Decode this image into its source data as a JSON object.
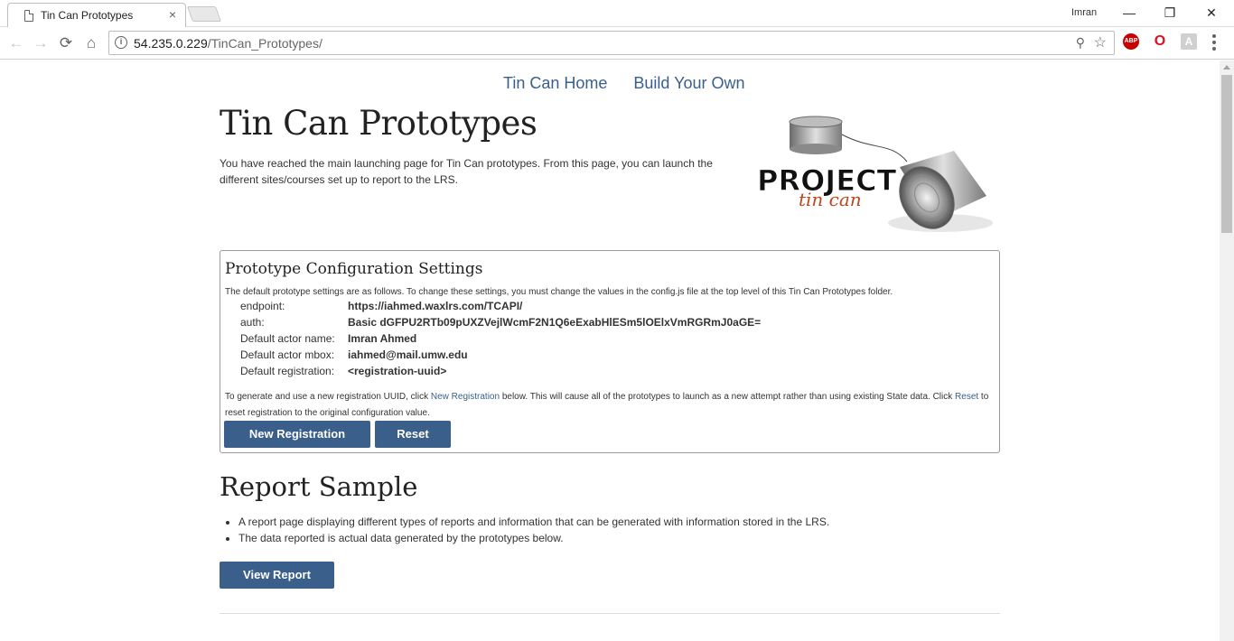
{
  "browser": {
    "tab_title": "Tin Can Prototypes",
    "tab_close": "×",
    "user_name": "Imran",
    "url_host": "54.235.0.229",
    "url_path": "/TinCan_Prototypes/",
    "info_glyph": "i",
    "ext_abp": "ABP",
    "ext_opera": "O",
    "ext_pdf": "A",
    "btn_minimize": "—",
    "btn_restore": "❐",
    "btn_close": "✕"
  },
  "page": {
    "nav": [
      "Tin Can Home",
      "Build Your Own"
    ],
    "title": "Tin Can Prototypes",
    "intro": "You have reached the main launching page for Tin Can prototypes. From this page, you can launch the different sites/courses set up to report to the LRS.",
    "logo": {
      "word1": "PROJECT",
      "word2": "tin can"
    },
    "config": {
      "heading": "Prototype Configuration Settings",
      "description": "The default prototype settings are as follows. To change these settings, you must change the values in the config.js file at the top level of this Tin Can Prototypes folder.",
      "rows": [
        {
          "key": "endpoint:",
          "value": "https://iahmed.waxlrs.com/TCAPI/"
        },
        {
          "key": "auth:",
          "value": "Basic dGFPU2RTb09pUXZVejlWcmF2N1Q6eExabHlESm5lOElxVmRGRmJ0aGE="
        },
        {
          "key": "Default actor name:",
          "value": "Imran Ahmed"
        },
        {
          "key": "Default actor mbox:",
          "value": "iahmed@mail.umw.edu"
        },
        {
          "key": "Default registration:",
          "value": "<registration-uuid>"
        }
      ],
      "help_part1": "To generate and use a new registration UUID, click ",
      "help_link1": "New Registration",
      "help_part2": " below. This will cause all of the prototypes to launch as a new attempt rather than using existing State data. Click ",
      "help_link2": "Reset",
      "help_part3": " to reset registration to the original configuration value.",
      "btn_new": "New Registration",
      "btn_reset": "Reset"
    },
    "report": {
      "heading": "Report Sample",
      "items": [
        "A report page displaying different types of reports and information that can be generated with information stored in the LRS.",
        "The data reported is actual data generated by the prototypes below."
      ],
      "btn": "View Report"
    }
  }
}
